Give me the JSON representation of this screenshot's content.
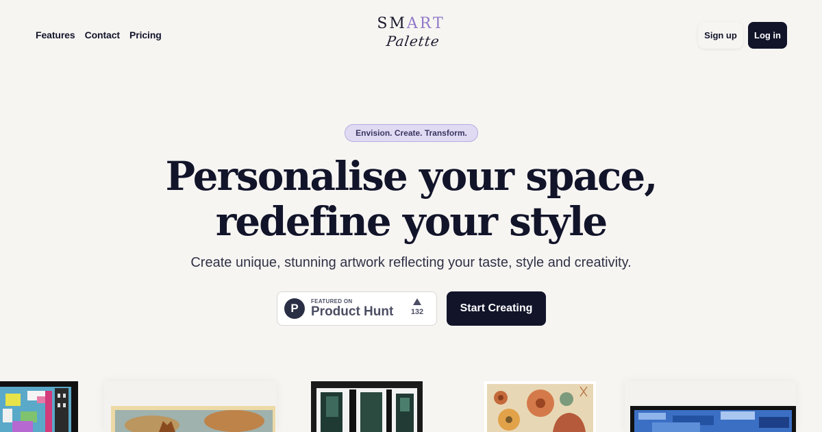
{
  "nav": {
    "links": [
      "Features",
      "Contact",
      "Pricing"
    ]
  },
  "logo": {
    "top_prefix": "SM",
    "top_accent": "ART",
    "script": "Palette"
  },
  "auth": {
    "signup_label": "Sign up",
    "login_label": "Log in"
  },
  "hero": {
    "tagline": "Envision. Create. Transform.",
    "headline_line1": "Personalise your space,",
    "headline_line2": "redefine your style",
    "subtitle": "Create unique, stunning artwork reflecting your taste, style and creativity."
  },
  "product_hunt": {
    "featured_label": "FEATURED ON",
    "name": "Product Hunt",
    "logo_letter": "P",
    "votes": "132"
  },
  "cta": {
    "start_label": "Start Creating"
  },
  "colors": {
    "background": "#f7f5f2",
    "primary": "#12142a",
    "accent": "#8f78c7",
    "pill_bg": "#e0dbf3"
  },
  "gallery": {
    "artworks": [
      "graffiti-collage",
      "fox-landscape",
      "dark-architecture",
      "floral-botanical",
      "blue-abstract"
    ]
  }
}
